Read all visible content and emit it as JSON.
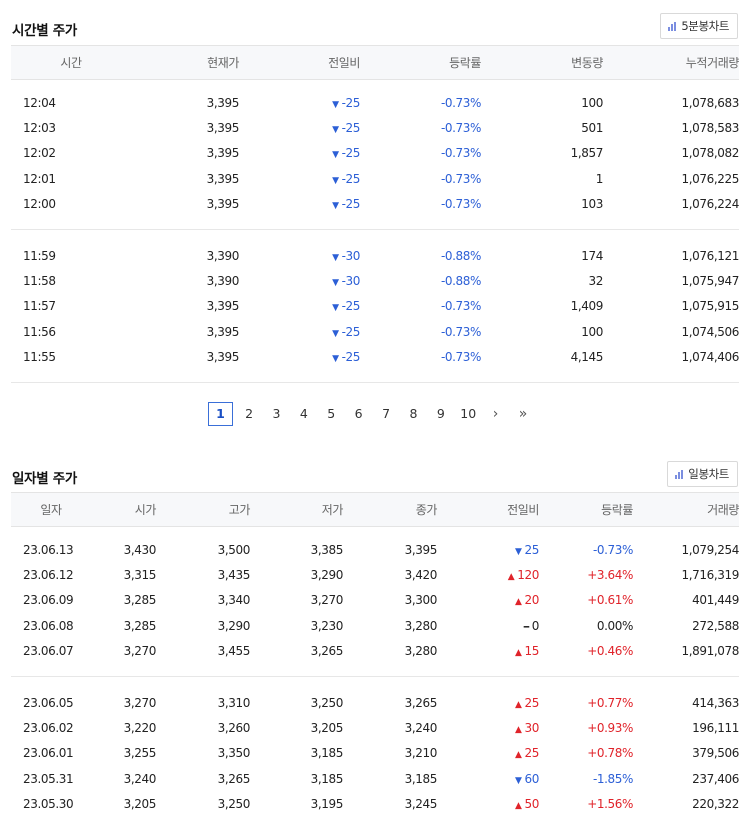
{
  "intraday": {
    "title": "시간별 주가",
    "chart_button": "5분봉차트",
    "headers": [
      "시간",
      "현재가",
      "전일비",
      "등락률",
      "변동량",
      "누적거래량"
    ],
    "groups": [
      [
        {
          "time": "12:04",
          "price": "3,395",
          "dir": "down",
          "change": "-25",
          "rate": "-0.73%",
          "vol": "100",
          "cum": "1,078,683"
        },
        {
          "time": "12:03",
          "price": "3,395",
          "dir": "down",
          "change": "-25",
          "rate": "-0.73%",
          "vol": "501",
          "cum": "1,078,583"
        },
        {
          "time": "12:02",
          "price": "3,395",
          "dir": "down",
          "change": "-25",
          "rate": "-0.73%",
          "vol": "1,857",
          "cum": "1,078,082"
        },
        {
          "time": "12:01",
          "price": "3,395",
          "dir": "down",
          "change": "-25",
          "rate": "-0.73%",
          "vol": "1",
          "cum": "1,076,225"
        },
        {
          "time": "12:00",
          "price": "3,395",
          "dir": "down",
          "change": "-25",
          "rate": "-0.73%",
          "vol": "103",
          "cum": "1,076,224"
        }
      ],
      [
        {
          "time": "11:59",
          "price": "3,390",
          "dir": "down",
          "change": "-30",
          "rate": "-0.88%",
          "vol": "174",
          "cum": "1,076,121"
        },
        {
          "time": "11:58",
          "price": "3,390",
          "dir": "down",
          "change": "-30",
          "rate": "-0.88%",
          "vol": "32",
          "cum": "1,075,947"
        },
        {
          "time": "11:57",
          "price": "3,395",
          "dir": "down",
          "change": "-25",
          "rate": "-0.73%",
          "vol": "1,409",
          "cum": "1,075,915"
        },
        {
          "time": "11:56",
          "price": "3,395",
          "dir": "down",
          "change": "-25",
          "rate": "-0.73%",
          "vol": "100",
          "cum": "1,074,506"
        },
        {
          "time": "11:55",
          "price": "3,395",
          "dir": "down",
          "change": "-25",
          "rate": "-0.73%",
          "vol": "4,145",
          "cum": "1,074,406"
        }
      ]
    ]
  },
  "pagination": {
    "pages": [
      "1",
      "2",
      "3",
      "4",
      "5",
      "6",
      "7",
      "8",
      "9",
      "10"
    ],
    "active": "1",
    "next": "›",
    "last": "»"
  },
  "daily": {
    "title": "일자별 주가",
    "chart_button": "일봉차트",
    "headers": [
      "일자",
      "시가",
      "고가",
      "저가",
      "종가",
      "전일비",
      "등락률",
      "거래량"
    ],
    "groups": [
      [
        {
          "date": "23.06.13",
          "open": "3,430",
          "high": "3,500",
          "low": "3,385",
          "close": "3,395",
          "dir": "down",
          "change": "25",
          "rate": "-0.73%",
          "vol": "1,079,254"
        },
        {
          "date": "23.06.12",
          "open": "3,315",
          "high": "3,435",
          "low": "3,290",
          "close": "3,420",
          "dir": "up",
          "change": "120",
          "rate": "+3.64%",
          "vol": "1,716,319"
        },
        {
          "date": "23.06.09",
          "open": "3,285",
          "high": "3,340",
          "low": "3,270",
          "close": "3,300",
          "dir": "up",
          "change": "20",
          "rate": "+0.61%",
          "vol": "401,449"
        },
        {
          "date": "23.06.08",
          "open": "3,285",
          "high": "3,290",
          "low": "3,230",
          "close": "3,280",
          "dir": "flat",
          "change": "0",
          "rate": "0.00%",
          "vol": "272,588"
        },
        {
          "date": "23.06.07",
          "open": "3,270",
          "high": "3,455",
          "low": "3,265",
          "close": "3,280",
          "dir": "up",
          "change": "15",
          "rate": "+0.46%",
          "vol": "1,891,078"
        }
      ],
      [
        {
          "date": "23.06.05",
          "open": "3,270",
          "high": "3,310",
          "low": "3,250",
          "close": "3,265",
          "dir": "up",
          "change": "25",
          "rate": "+0.77%",
          "vol": "414,363"
        },
        {
          "date": "23.06.02",
          "open": "3,220",
          "high": "3,260",
          "low": "3,205",
          "close": "3,240",
          "dir": "up",
          "change": "30",
          "rate": "+0.93%",
          "vol": "196,111"
        },
        {
          "date": "23.06.01",
          "open": "3,255",
          "high": "3,350",
          "low": "3,185",
          "close": "3,210",
          "dir": "up",
          "change": "25",
          "rate": "+0.78%",
          "vol": "379,506"
        },
        {
          "date": "23.05.31",
          "open": "3,240",
          "high": "3,265",
          "low": "3,185",
          "close": "3,185",
          "dir": "down",
          "change": "60",
          "rate": "-1.85%",
          "vol": "237,406"
        },
        {
          "date": "23.05.30",
          "open": "3,205",
          "high": "3,250",
          "low": "3,195",
          "close": "3,245",
          "dir": "up",
          "change": "50",
          "rate": "+1.56%",
          "vol": "220,322"
        }
      ]
    ]
  },
  "colors": {
    "up": "#e0232a",
    "down": "#2c5fd6",
    "active_page": "#3a6fd8"
  },
  "icons": {
    "chart": "bar-chart-icon",
    "up": "triangle-up-icon",
    "down": "triangle-down-icon",
    "flat": "dash-icon"
  }
}
